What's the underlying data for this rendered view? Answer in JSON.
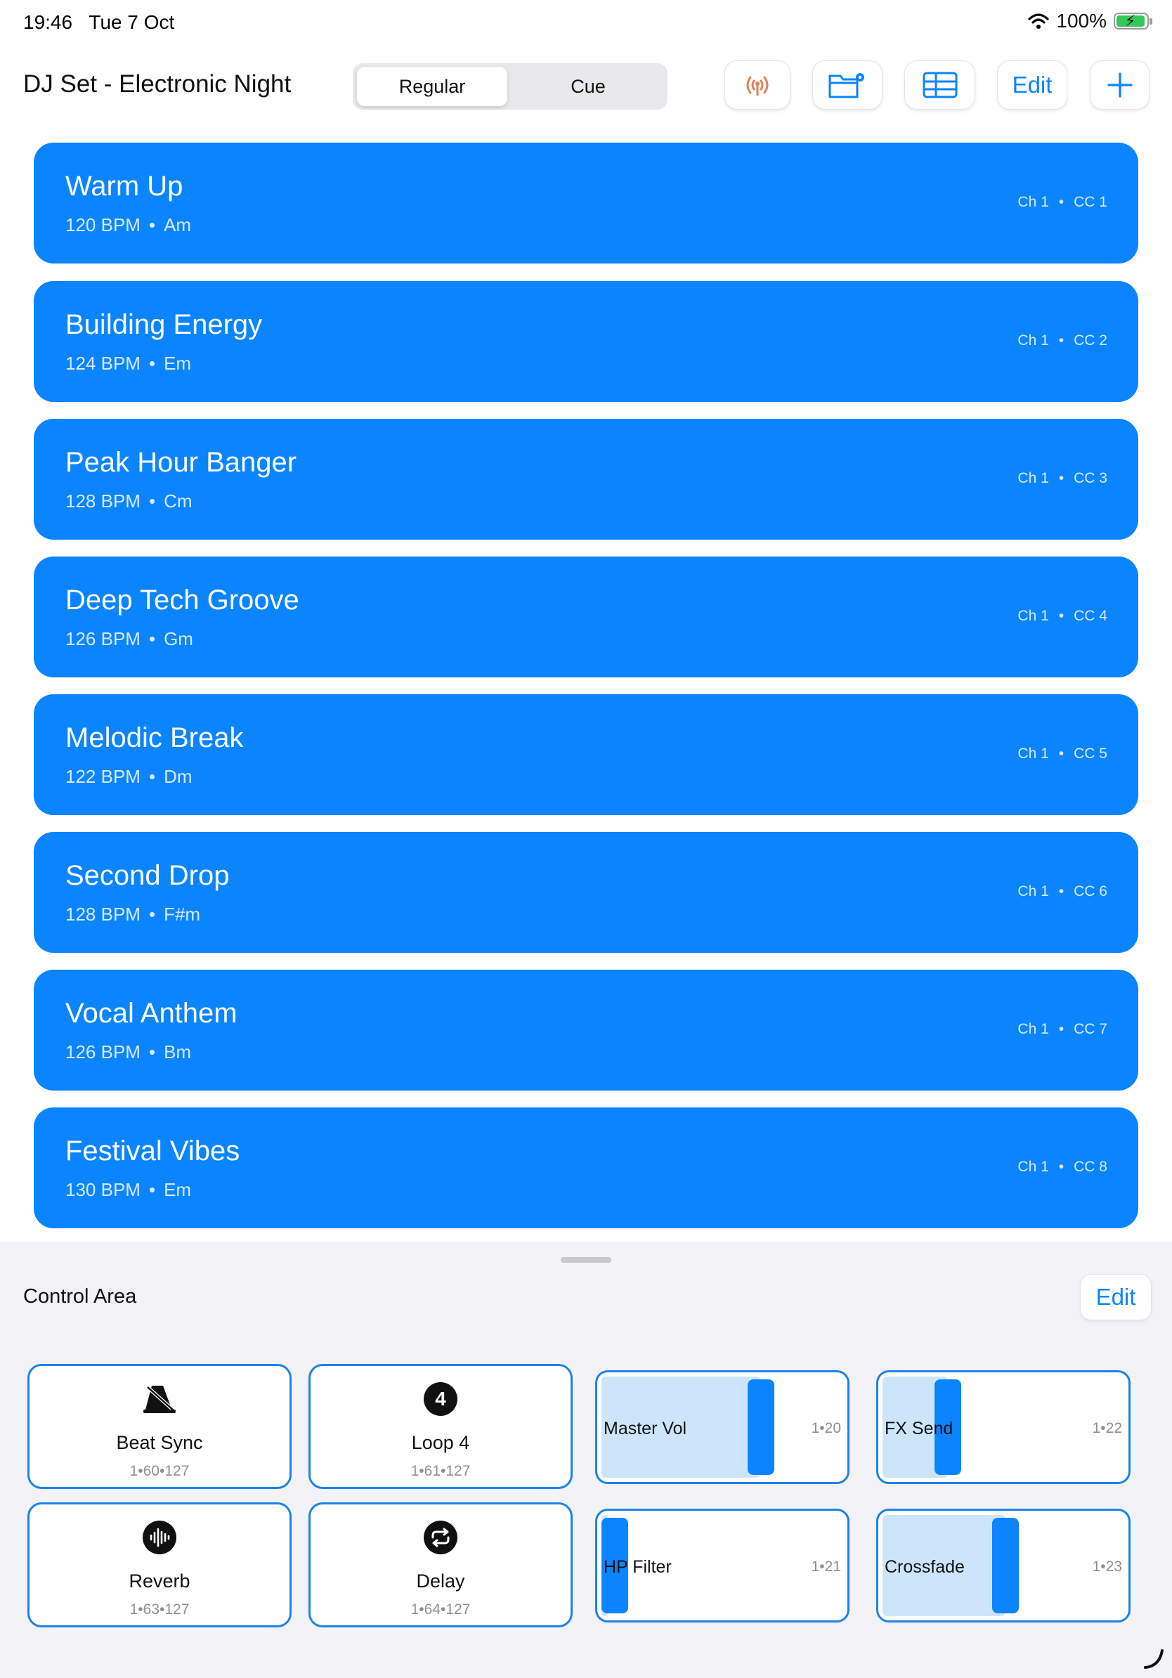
{
  "status_bar": {
    "time": "19:46",
    "date": "Tue 7 Oct",
    "battery": "100%"
  },
  "header": {
    "title": "DJ Set - Electronic Night",
    "segments": [
      "Regular",
      "Cue"
    ],
    "selected_segment": "Regular",
    "edit_label": "Edit",
    "icons": [
      "broadcast-icon",
      "folder-settings-icon",
      "table-icon",
      "plus-icon"
    ]
  },
  "songs": [
    {
      "name": "Warm Up",
      "bpm": "120 BPM",
      "key": "Am",
      "ch": "Ch 1",
      "cc": "CC 1"
    },
    {
      "name": "Building Energy",
      "bpm": "124 BPM",
      "key": "Em",
      "ch": "Ch 1",
      "cc": "CC 2"
    },
    {
      "name": "Peak Hour Banger",
      "bpm": "128 BPM",
      "key": "Cm",
      "ch": "Ch 1",
      "cc": "CC 3"
    },
    {
      "name": "Deep Tech Groove",
      "bpm": "126 BPM",
      "key": "Gm",
      "ch": "Ch 1",
      "cc": "CC 4"
    },
    {
      "name": "Melodic Break",
      "bpm": "122 BPM",
      "key": "Dm",
      "ch": "Ch 1",
      "cc": "CC 5"
    },
    {
      "name": "Second Drop",
      "bpm": "128 BPM",
      "key": "F#m",
      "ch": "Ch 1",
      "cc": "CC 6"
    },
    {
      "name": "Vocal Anthem",
      "bpm": "126 BPM",
      "key": "Bm",
      "ch": "Ch 1",
      "cc": "CC 7"
    },
    {
      "name": "Festival Vibes",
      "bpm": "130 BPM",
      "key": "Em",
      "ch": "Ch 1",
      "cc": "CC 8"
    }
  ],
  "separator": "•",
  "control_area": {
    "title": "Control Area",
    "edit_label": "Edit",
    "buttons": [
      {
        "label": "Beat Sync",
        "meta": "1•60•127",
        "icon": "metronome-off-icon"
      },
      {
        "label": "Loop 4",
        "meta": "1•61•127",
        "icon": "number-4-circle-icon",
        "icon_text": "4"
      },
      {
        "label": "Reverb",
        "meta": "1•63•127",
        "icon": "waveform-circle-icon"
      },
      {
        "label": "Delay",
        "meta": "1•64•127",
        "icon": "repeat-circle-icon"
      }
    ],
    "faders": [
      {
        "label": "Master Vol",
        "meta": "1•20",
        "level": 0.66
      },
      {
        "label": "FX Send",
        "meta": "1•22",
        "level": 0.27
      },
      {
        "label": "HP Filter",
        "meta": "1•21",
        "level": 0.03
      },
      {
        "label": "Crossfade",
        "meta": "1•23",
        "level": 0.51
      }
    ]
  },
  "colors": {
    "accent": "#0a84ff",
    "row": "#0a84ff",
    "tile_border": "#1c82ea",
    "fader_fill": "#cde5fb",
    "broadcast": "#e0825a"
  }
}
